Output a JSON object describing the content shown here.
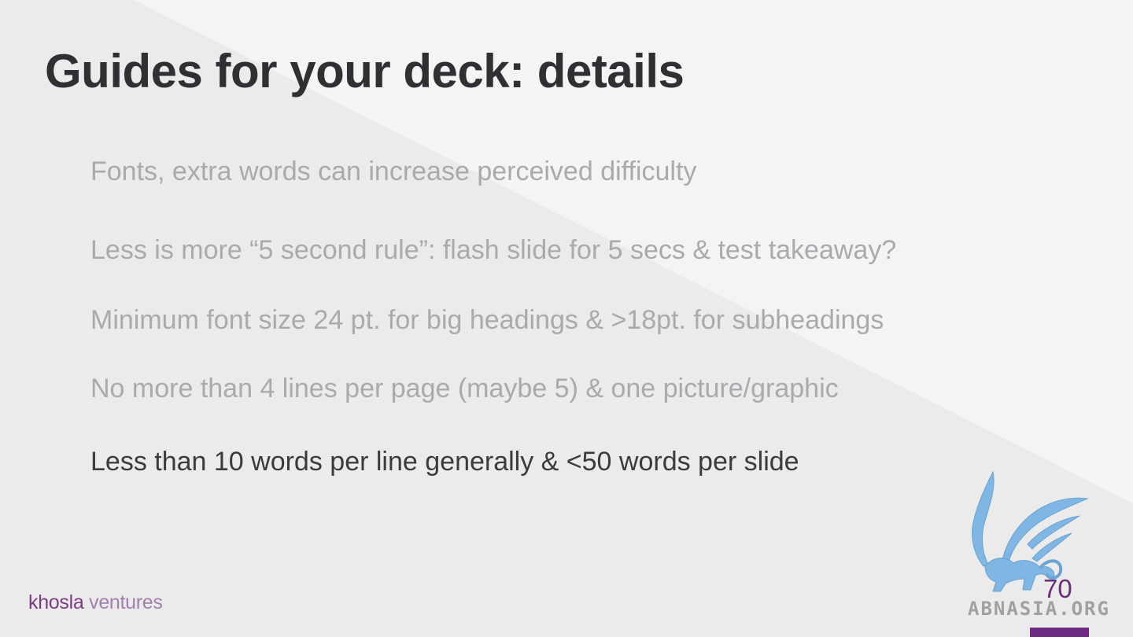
{
  "slide": {
    "title": "Guides for your deck: details",
    "bullets": [
      {
        "text": "Fonts, extra words can increase perceived difficulty",
        "highlighted": false
      },
      {
        "text": "Less is more “5 second rule”: flash slide for 5 secs & test  takeaway?",
        "highlighted": false
      },
      {
        "text": "Minimum font size 24 pt. for big headings & >18pt. for subheadings",
        "highlighted": false
      },
      {
        "text": "No more than 4 lines per page (maybe 5) & one picture/graphic",
        "highlighted": false
      },
      {
        "text": "Less than 10 words per line generally & <50 words per slide",
        "highlighted": true
      }
    ],
    "page_number": "70"
  },
  "footer": {
    "brand_part1": "khosla",
    "brand_part2": "ventures"
  },
  "watermark": {
    "icon": "griffin-logo-icon",
    "text": "ABNASIA.ORG"
  },
  "colors": {
    "title": "#2f3033",
    "bullet_muted": "#a9aaad",
    "bullet_active": "#3a3b3f",
    "brand_purple": "#7b3b84",
    "brand_light_purple": "#a47fae",
    "accent_bar": "#6e2a82",
    "watermark_blue": "#7fb6e3"
  }
}
